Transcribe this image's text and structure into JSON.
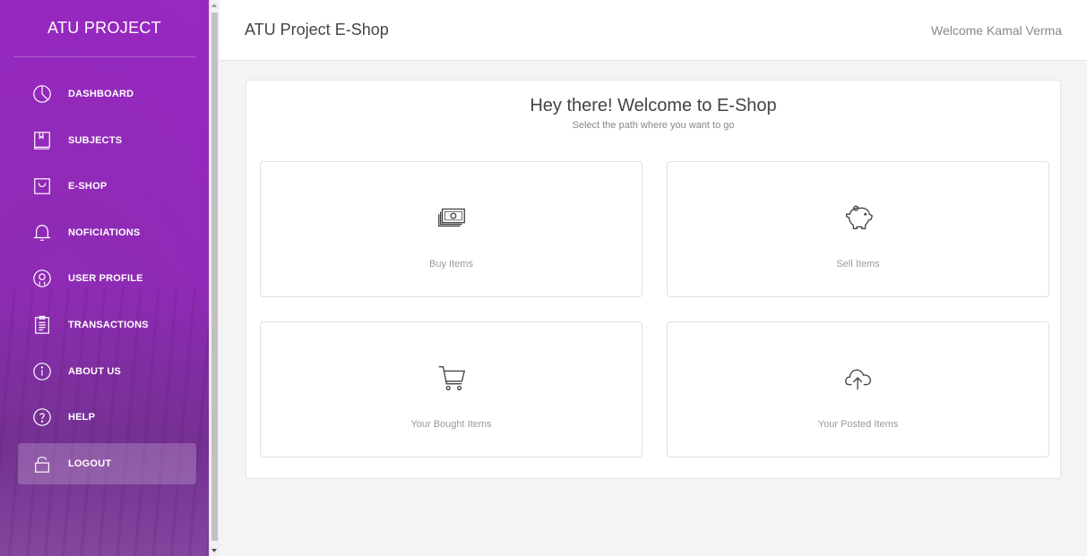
{
  "sidebar": {
    "brand": "ATU PROJECT",
    "items": [
      {
        "label": "DASHBOARD",
        "icon": "pie-chart-icon"
      },
      {
        "label": "SUBJECTS",
        "icon": "book-icon"
      },
      {
        "label": "E-SHOP",
        "icon": "shopping-bag-icon"
      },
      {
        "label": "NOFICIATIONS",
        "icon": "bell-icon"
      },
      {
        "label": "USER PROFILE",
        "icon": "user-icon"
      },
      {
        "label": "TRANSACTIONS",
        "icon": "clipboard-icon"
      },
      {
        "label": "ABOUT US",
        "icon": "info-icon"
      },
      {
        "label": "HELP",
        "icon": "help-icon"
      },
      {
        "label": "LOGOUT",
        "icon": "lock-icon",
        "active": true
      }
    ]
  },
  "header": {
    "title": "ATU Project E-Shop",
    "welcome": "Welcome Kamal Verma"
  },
  "main": {
    "title": "Hey there! Welcome to E-Shop",
    "subtitle": "Select the path where you want to go",
    "options": [
      {
        "label": "Buy Items",
        "icon": "money-icon"
      },
      {
        "label": "Sell Items",
        "icon": "piggy-bank-icon"
      },
      {
        "label": "Your Bought Items",
        "icon": "cart-icon"
      },
      {
        "label": "Your Posted Items",
        "icon": "cloud-upload-icon"
      }
    ]
  },
  "colors": {
    "sidebar": "#9c27c7",
    "background": "#f4f4f6"
  }
}
